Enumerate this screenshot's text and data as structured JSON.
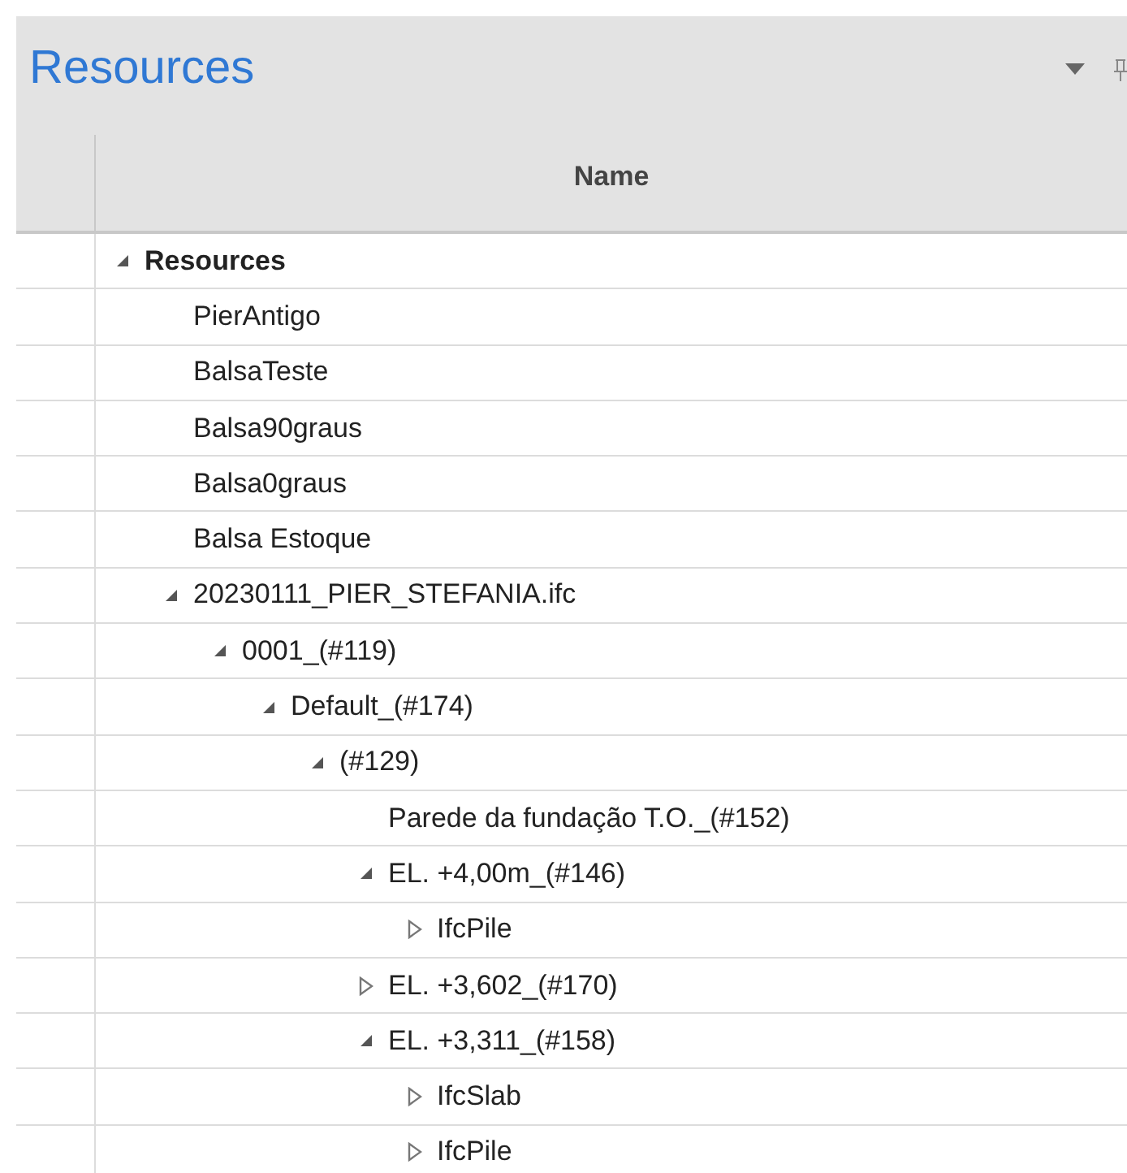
{
  "panel": {
    "title": "Resources"
  },
  "table": {
    "columns": [
      "Name"
    ],
    "tree": [
      {
        "label": "Resources",
        "kind": "branch",
        "expanded": true,
        "children": [
          {
            "label": "PierAntigo",
            "kind": "leaf"
          },
          {
            "label": "BalsaTeste",
            "kind": "leaf"
          },
          {
            "label": "Balsa90graus",
            "kind": "leaf"
          },
          {
            "label": "Balsa0graus",
            "kind": "leaf"
          },
          {
            "label": "Balsa Estoque",
            "kind": "leaf"
          },
          {
            "label": "20230111_PIER_STEFANIA.ifc",
            "kind": "branch",
            "expanded": true,
            "children": [
              {
                "label": "0001_(#119)",
                "kind": "branch",
                "expanded": true,
                "children": [
                  {
                    "label": "Default_(#174)",
                    "kind": "branch",
                    "expanded": true,
                    "children": [
                      {
                        "label": "(#129)",
                        "kind": "branch",
                        "expanded": true,
                        "children": [
                          {
                            "label": "Parede da fundação T.O._(#152)",
                            "kind": "leaf"
                          },
                          {
                            "label": "EL. +4,00m_(#146)",
                            "kind": "branch",
                            "expanded": true,
                            "children": [
                              {
                                "label": "IfcPile",
                                "kind": "branch",
                                "expanded": false
                              }
                            ]
                          },
                          {
                            "label": "EL. +3,602_(#170)",
                            "kind": "branch",
                            "expanded": false
                          },
                          {
                            "label": "EL. +3,311_(#158)",
                            "kind": "branch",
                            "expanded": true,
                            "children": [
                              {
                                "label": "IfcSlab",
                                "kind": "branch",
                                "expanded": false
                              },
                              {
                                "label": "IfcPile",
                                "kind": "branch",
                                "expanded": false
                              }
                            ]
                          }
                        ]
                      }
                    ]
                  }
                ]
              }
            ]
          }
        ]
      }
    ]
  }
}
